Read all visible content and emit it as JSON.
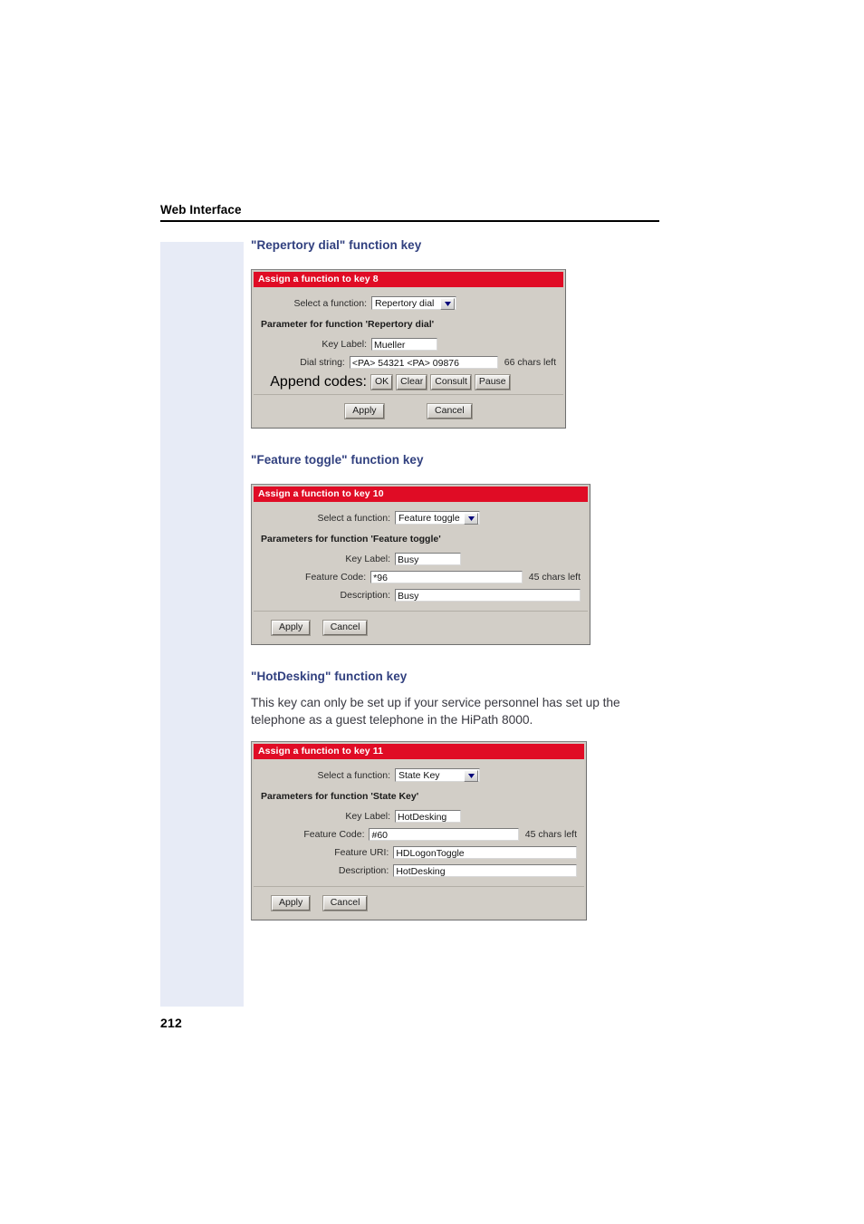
{
  "page": {
    "running_head": "Web Interface",
    "folio": "212"
  },
  "sections": [
    {
      "title": "\"Repertory dial\" function key"
    },
    {
      "title": "\"Feature toggle\" function key"
    },
    {
      "title": "\"HotDesking\" function key",
      "body": "This key can only be set up if your service personnel has set up the telephone as a guest telephone in the HiPath 8000."
    }
  ],
  "dialog1": {
    "titlebar": "Assign a function to key 8",
    "select_label": "Select a function:",
    "select_value": "Repertory dial",
    "param_heading": "Parameter for function 'Repertory dial'",
    "key_label_label": "Key Label:",
    "key_label_value": "Mueller",
    "dial_string_label": "Dial string:",
    "dial_string_value": "<PA> 54321 <PA> 09876",
    "chars_left": "66 chars left",
    "append_label": "Append codes:",
    "append_buttons": [
      "OK",
      "Clear",
      "Consult",
      "Pause"
    ],
    "apply_label": "Apply",
    "cancel_label": "Cancel"
  },
  "dialog2": {
    "titlebar": "Assign a function to key 10",
    "select_label": "Select a function:",
    "select_value": "Feature toggle",
    "param_heading": "Parameters for function 'Feature toggle'",
    "key_label_label": "Key Label:",
    "key_label_value": "Busy",
    "feature_code_label": "Feature Code:",
    "feature_code_value": "*96",
    "chars_left": "45 chars left",
    "description_label": "Description:",
    "description_value": "Busy",
    "apply_label": "Apply",
    "cancel_label": "Cancel"
  },
  "dialog3": {
    "titlebar": "Assign a function to key 11",
    "select_label": "Select a function:",
    "select_value": "State Key",
    "param_heading": "Parameters for function 'State Key'",
    "key_label_label": "Key Label:",
    "key_label_value": "HotDesking",
    "feature_code_label": "Feature Code:",
    "feature_code_value": "#60",
    "chars_left": "45 chars left",
    "feature_uri_label": "Feature URI:",
    "feature_uri_value": "HDLogonToggle",
    "description_label": "Description:",
    "description_value": "HotDesking",
    "apply_label": "Apply",
    "cancel_label": "Cancel"
  },
  "colors": {
    "heading": "#31407f",
    "titlebar_red": "#e00c25",
    "margin_tint": "#e7ebf6",
    "dialog_face": "#d2cec7"
  }
}
